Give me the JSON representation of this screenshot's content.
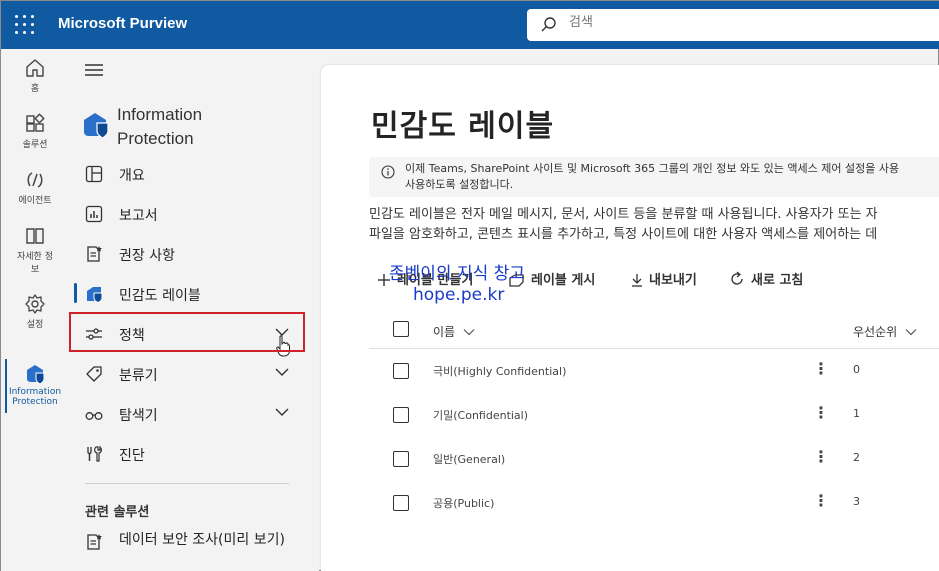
{
  "header": {
    "app_name": "Microsoft Purview",
    "search_placeholder": "검색",
    "bg_color": "#0f5aa0"
  },
  "rail": {
    "items": [
      {
        "label": "홈",
        "icon": "home-icon"
      },
      {
        "label": "솔루션",
        "icon": "solutions-icon"
      },
      {
        "label": "에이전트",
        "icon": "agents-icon"
      },
      {
        "label_line1": "자세한 정",
        "label_line2": "보",
        "icon": "learn-icon"
      },
      {
        "label": "설정",
        "icon": "settings-icon"
      },
      {
        "label_line1": "Information",
        "label_line2": "Protection",
        "icon": "information-protection-icon",
        "active": true
      }
    ]
  },
  "nav": {
    "title_line1": "Information",
    "title_line2": "Protection",
    "items": [
      {
        "label": "개요",
        "icon": "overview-icon"
      },
      {
        "label": "보고서",
        "icon": "reports-icon"
      },
      {
        "label": "권장 사항",
        "icon": "recommendations-icon"
      },
      {
        "label": "민감도 레이블",
        "icon": "sensitivity-label-icon",
        "selected": true
      },
      {
        "label": "정책",
        "icon": "policies-icon",
        "expandable": true
      },
      {
        "label": "분류기",
        "icon": "classifiers-icon",
        "expandable": true
      },
      {
        "label": "탐색기",
        "icon": "explorers-icon",
        "expandable": true
      },
      {
        "label": "진단",
        "icon": "diagnostics-icon"
      }
    ],
    "related_section": "관련 솔루션",
    "related_items": [
      {
        "label": "데이터 보안 조사(미리 보기)",
        "icon": "data-security-icon"
      }
    ]
  },
  "main": {
    "title": "민감도 레이블",
    "info_line1": "이제 Teams, SharePoint 사이트 및 Microsoft 365 그룹의 개인 정보 와도 있는 액세스 제어 설정을 사용",
    "info_line2": "사용하도록 설정합니다.",
    "desc_line1": "민감도 레이블은 전자 메일 메시지, 문서, 사이트 등을 분류할 때 사용됩니다. 사용자가 또는 자",
    "desc_line2": "파일을 암호화하고, 콘텐츠 표시를 추가하고, 특정 사이트에 대한 사용자 액세스를 제어하는 데",
    "toolbar": {
      "create": "레이블 만들기",
      "publish": "레이블 게시",
      "export": "내보내기",
      "refresh": "새로 고침"
    },
    "watermark_line1": "존벤이의 지식 창고",
    "watermark_line2": "hope.pe.kr",
    "table": {
      "col_name": "이름",
      "col_priority": "우선순위",
      "rows": [
        {
          "name": "극비(Highly Confidential)",
          "priority": "0"
        },
        {
          "name": "기밀(Confidential)",
          "priority": "1"
        },
        {
          "name": "일반(General)",
          "priority": "2"
        },
        {
          "name": "공용(Public)",
          "priority": "3"
        }
      ],
      "more_glyph": "⋮"
    }
  }
}
